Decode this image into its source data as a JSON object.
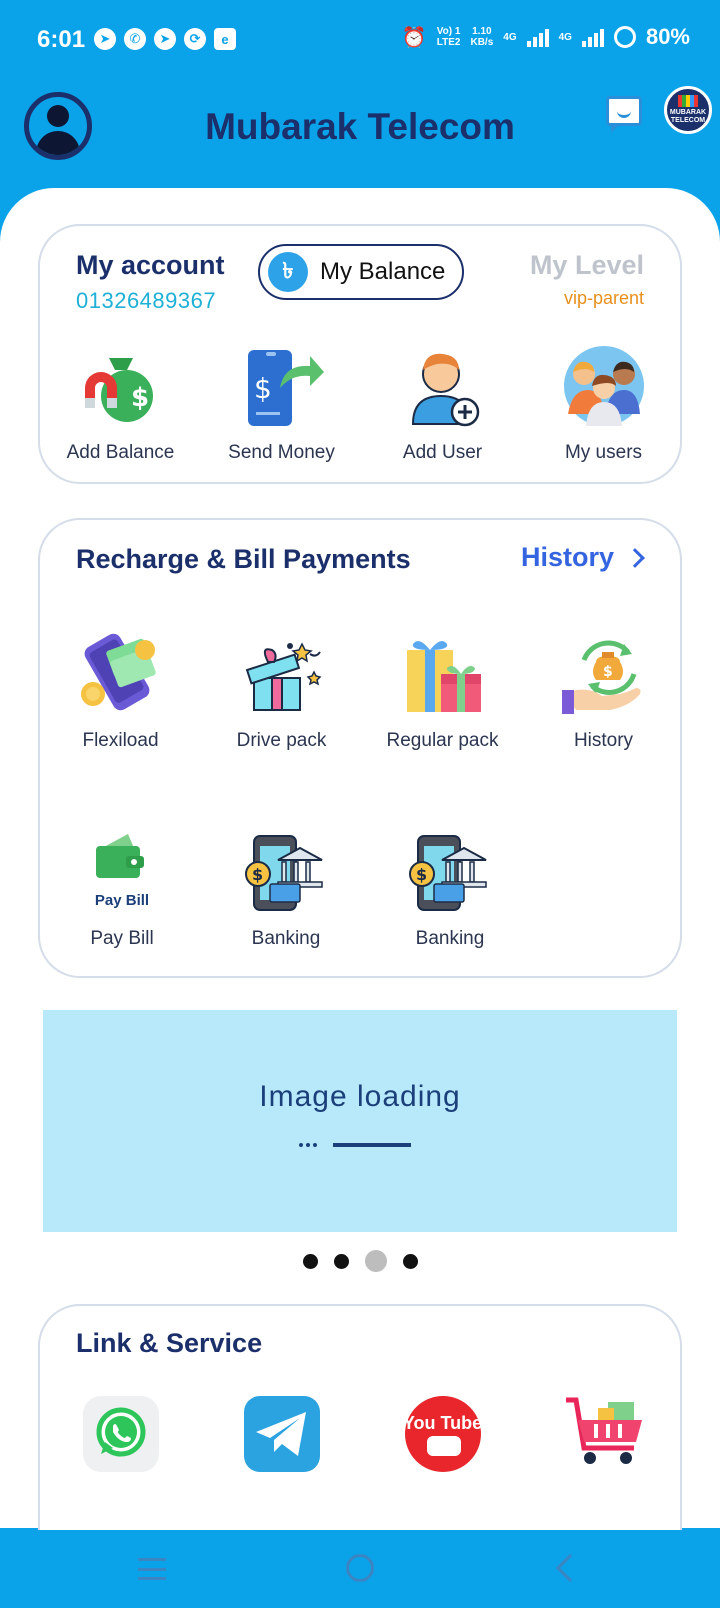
{
  "status_bar": {
    "time": "6:01",
    "network_top": "Vo) 1",
    "network_bottom": "LTE2",
    "speed_top": "1.10",
    "speed_bottom": "KB/s",
    "sim1": "4G",
    "sim2": "4G",
    "battery": "80%"
  },
  "header": {
    "title": "Mubarak Telecom",
    "logo_text": "MUBARAK TELECOM"
  },
  "account": {
    "title": "My account",
    "phone": "01326489367",
    "balance_icon": "৳",
    "balance_label": "My Balance",
    "level_title": "My Level",
    "level_value": "vip-parent",
    "actions": [
      {
        "label": "Add Balance",
        "icon": "money-bag-magnet-icon"
      },
      {
        "label": "Send Money",
        "icon": "phone-send-money-icon"
      },
      {
        "label": "Add User",
        "icon": "add-user-icon"
      },
      {
        "label": "My users",
        "icon": "users-group-icon"
      }
    ]
  },
  "recharge": {
    "title": "Recharge & Bill Payments",
    "history_link": "History",
    "items": [
      {
        "label": "Flexiload",
        "icon": "phone-cash-icon"
      },
      {
        "label": "Drive pack",
        "icon": "gift-box-icon"
      },
      {
        "label": "Regular pack",
        "icon": "gift-boxes-icon"
      },
      {
        "label": "History",
        "icon": "hand-money-cycle-icon"
      },
      {
        "label": "Pay Bill",
        "icon": "wallet-icon",
        "icon_caption": "Pay Bill"
      },
      {
        "label": "Banking",
        "icon": "mobile-banking-icon"
      },
      {
        "label": "Banking",
        "icon": "mobile-banking-icon"
      }
    ]
  },
  "banner": {
    "text": "Image loading",
    "pager_count": 4,
    "pager_active": 3
  },
  "links": {
    "title": "Link & Service",
    "items": [
      {
        "icon": "whatsapp-icon"
      },
      {
        "icon": "telegram-icon"
      },
      {
        "icon": "youtube-icon",
        "text": "You Tube"
      },
      {
        "icon": "shopping-cart-icon"
      }
    ]
  },
  "colors": {
    "primary": "#0aa3ea",
    "navy": "#1b2f6b",
    "accent_blue": "#3464e0",
    "phone_cyan": "#1eb0d6",
    "level_orange": "#e8901c"
  }
}
